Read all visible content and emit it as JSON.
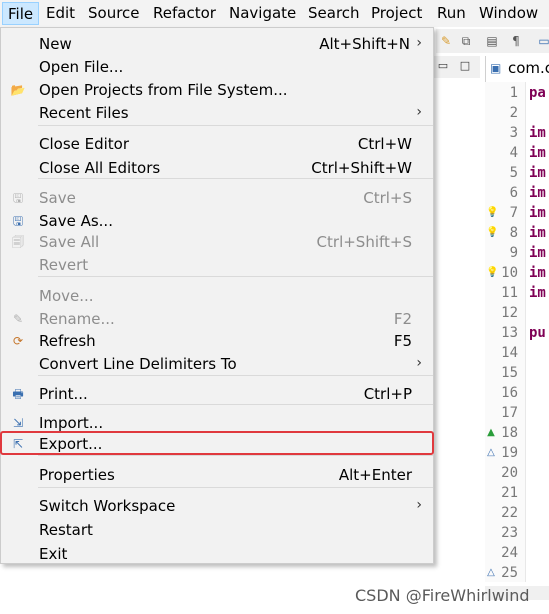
{
  "menubar": {
    "items": [
      "File",
      "Edit",
      "Source",
      "Refactor",
      "Navigate",
      "Search",
      "Project",
      "Run",
      "Window"
    ],
    "active": "File"
  },
  "file_menu": {
    "items": [
      {
        "label": "New",
        "shortcut": "Alt+Shift+N",
        "submenu": true,
        "enabled": true,
        "icon": ""
      },
      {
        "label": "Open File...",
        "shortcut": "",
        "submenu": false,
        "enabled": true,
        "icon": ""
      },
      {
        "label": "Open Projects from File System...",
        "shortcut": "",
        "submenu": false,
        "enabled": true,
        "icon": "folder-icon"
      },
      {
        "label": "Recent Files",
        "shortcut": "",
        "submenu": true,
        "enabled": true,
        "icon": ""
      },
      {
        "label": "Close Editor",
        "shortcut": "Ctrl+W",
        "submenu": false,
        "enabled": true,
        "icon": ""
      },
      {
        "label": "Close All Editors",
        "shortcut": "Ctrl+Shift+W",
        "submenu": false,
        "enabled": true,
        "icon": ""
      },
      {
        "label": "Save",
        "shortcut": "Ctrl+S",
        "submenu": false,
        "enabled": false,
        "icon": "save-icon"
      },
      {
        "label": "Save As...",
        "shortcut": "",
        "submenu": false,
        "enabled": true,
        "icon": "save-as-icon"
      },
      {
        "label": "Save All",
        "shortcut": "Ctrl+Shift+S",
        "submenu": false,
        "enabled": false,
        "icon": "save-all-icon"
      },
      {
        "label": "Revert",
        "shortcut": "",
        "submenu": false,
        "enabled": false,
        "icon": ""
      },
      {
        "label": "Move...",
        "shortcut": "",
        "submenu": false,
        "enabled": false,
        "icon": ""
      },
      {
        "label": "Rename...",
        "shortcut": "F2",
        "submenu": false,
        "enabled": false,
        "icon": "rename-icon"
      },
      {
        "label": "Refresh",
        "shortcut": "F5",
        "submenu": false,
        "enabled": true,
        "icon": "refresh-icon"
      },
      {
        "label": "Convert Line Delimiters To",
        "shortcut": "",
        "submenu": true,
        "enabled": true,
        "icon": ""
      },
      {
        "label": "Print...",
        "shortcut": "Ctrl+P",
        "submenu": false,
        "enabled": true,
        "icon": "print-icon"
      },
      {
        "label": "Import...",
        "shortcut": "",
        "submenu": false,
        "enabled": true,
        "icon": "import-icon"
      },
      {
        "label": "Export...",
        "shortcut": "",
        "submenu": false,
        "enabled": true,
        "icon": "export-icon"
      },
      {
        "label": "Properties",
        "shortcut": "Alt+Enter",
        "submenu": false,
        "enabled": true,
        "icon": ""
      },
      {
        "label": "Switch Workspace",
        "shortcut": "",
        "submenu": true,
        "enabled": true,
        "icon": ""
      },
      {
        "label": "Restart",
        "shortcut": "",
        "submenu": false,
        "enabled": true,
        "icon": ""
      },
      {
        "label": "Exit",
        "shortcut": "",
        "submenu": false,
        "enabled": true,
        "icon": ""
      }
    ],
    "highlighted": "Export..."
  },
  "editor": {
    "tab_label": "com.c",
    "line_numbers": [
      "1",
      "2",
      "3",
      "4",
      "5",
      "6",
      "7",
      "8",
      "9",
      "10",
      "11",
      "12",
      "13",
      "14",
      "15",
      "16",
      "17",
      "18",
      "19",
      "20",
      "21",
      "22",
      "23",
      "24",
      "25"
    ],
    "code_lines": {
      "1": "pa",
      "3": "im",
      "4": "im",
      "5": "im",
      "6": "im",
      "7": "im",
      "8": "im",
      "9": "im",
      "10": "im",
      "11": "im",
      "13": "pu"
    }
  },
  "watermark": "CSDN @FireWhirlwind",
  "colors": {
    "highlight_border": "#e0393e",
    "menu_bg": "#f2f2f2",
    "active_menubar": "#cce8ff",
    "keyword": "#7f0055"
  }
}
